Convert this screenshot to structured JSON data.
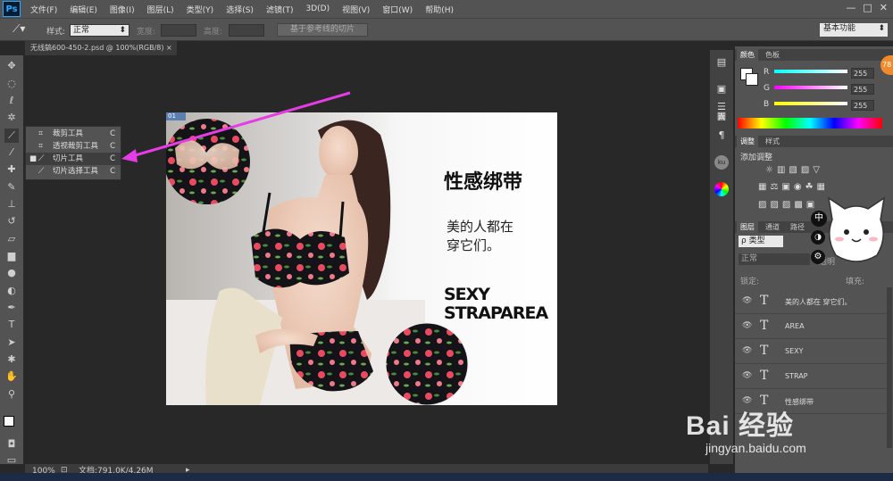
{
  "app": {
    "logo": "Ps",
    "title": "无线鎬600-450-2.psd @ 100%(RGB/8)",
    "tab_close": "×"
  },
  "menu": [
    "文件(F)",
    "编辑(E)",
    "图像(I)",
    "图层(L)",
    "类型(Y)",
    "选择(S)",
    "滤镜(T)",
    "3D(D)",
    "视图(V)",
    "窗口(W)",
    "帮助(H)"
  ],
  "window_controls": [
    "—",
    "□",
    "✕"
  ],
  "options": {
    "style_label": "样式:",
    "style_value": "正常",
    "width_label": "宽度:",
    "height_label": "高度:",
    "guides_button": "基于参考线的切片",
    "workspace": "基本功能"
  },
  "flyout": [
    {
      "label": "裁剪工具",
      "shortcut": "C",
      "selected": false
    },
    {
      "label": "透视裁剪工具",
      "shortcut": "C",
      "selected": false
    },
    {
      "label": "切片工具",
      "shortcut": "C",
      "selected": true
    },
    {
      "label": "切片选择工具",
      "shortcut": "C",
      "selected": false
    }
  ],
  "canvas": {
    "slice_badge": "01",
    "headline": "性感绑带",
    "subline1": "美的人都在",
    "subline2": "穿它们。",
    "en1": "SEXY",
    "en2": "STRAPAREA"
  },
  "status": {
    "zoom": "100%",
    "doc_info": "文档:791.0K/4.26M"
  },
  "color_panel": {
    "tabs": [
      "颜色",
      "色板"
    ],
    "channels": [
      {
        "name": "R",
        "value": "255"
      },
      {
        "name": "G",
        "value": "255"
      },
      {
        "name": "B",
        "value": "255"
      }
    ]
  },
  "adjust_panel": {
    "tabs": [
      "调整",
      "样式"
    ],
    "title": "添加调整"
  },
  "layers_panel": {
    "tabs": [
      "图层",
      "通道",
      "路径"
    ],
    "kind": "ρ 类型",
    "blend": "正常",
    "opacity_label": "透明",
    "lock_label": "锁定:",
    "fill_label": "填充:",
    "layers": [
      "美的人都在 穿它们。",
      "AREA",
      "SEXY",
      "STRAP",
      "性感绑带"
    ]
  },
  "overlay": {
    "ime": "中",
    "badge": "78",
    "watermark": "Bai 经验",
    "watermark_url": "jingyan.baidu.com"
  },
  "colors": {
    "accent": "#31a8ff",
    "arrow": "#e63ce6",
    "panel": "#535353"
  }
}
